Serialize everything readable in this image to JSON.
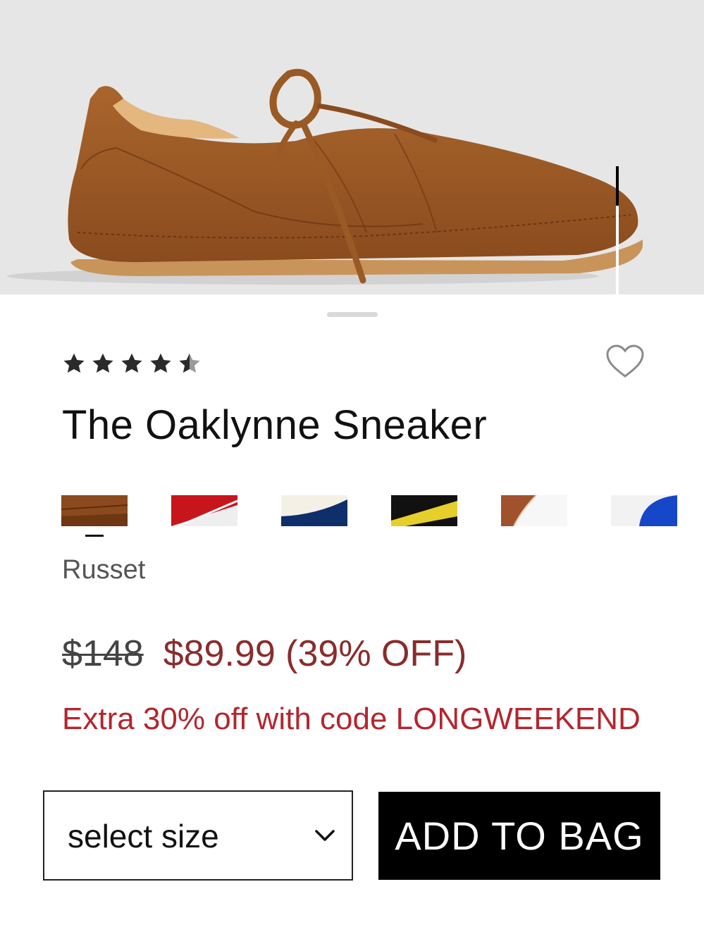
{
  "product": {
    "image": {
      "alt": "Brown suede low-top sneaker with laces",
      "icon": "sneaker-image"
    },
    "rating": {
      "value": 4.5,
      "max": 5
    },
    "title": "The Oaklynne Sneaker",
    "wishlist_icon": "heart-outline-icon",
    "swatches": [
      {
        "name": "russet",
        "colors": [
          "#8b4a1e",
          "#6e3612"
        ]
      },
      {
        "name": "red-white",
        "colors": [
          "#c8151b",
          "#ffffff",
          "#eeeeee"
        ]
      },
      {
        "name": "white-navy",
        "colors": [
          "#f4f0e6",
          "#0f2f6b"
        ]
      },
      {
        "name": "black-yellow",
        "colors": [
          "#111111",
          "#e7cf2b"
        ]
      },
      {
        "name": "tan-white",
        "colors": [
          "#a0522d",
          "#ffffff"
        ]
      },
      {
        "name": "white-blue",
        "colors": [
          "#f2f2f2",
          "#1747c9"
        ]
      }
    ],
    "selected_color": "Russet",
    "price": {
      "original": "$148",
      "sale": "$89.99 (39% OFF)"
    },
    "promo": "Extra 30% off with code LONGWEEKEND"
  },
  "actions": {
    "size_select": {
      "label": "select size",
      "icon": "chevron-down-icon"
    },
    "add_to_bag": "ADD TO BAG"
  },
  "colors": {
    "sale_price": "#8a2c2c",
    "promo": "#b3262e",
    "primary_button": "#000000"
  }
}
